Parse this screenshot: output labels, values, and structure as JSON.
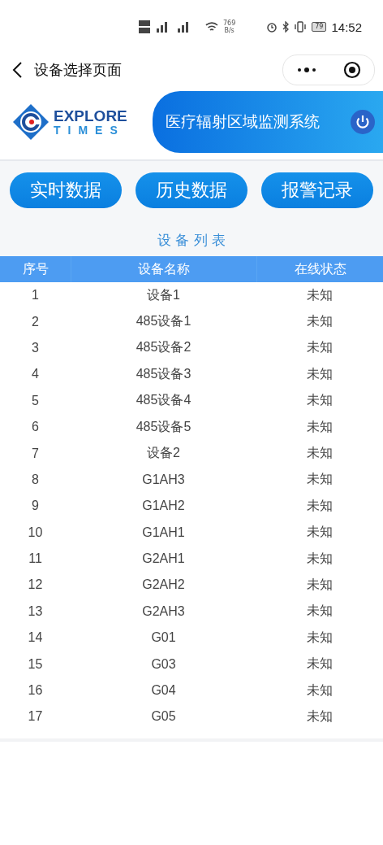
{
  "status_bar": {
    "speed": "769",
    "speed_unit": "B/s",
    "battery": "79",
    "time": "14:52"
  },
  "nav": {
    "title": "设备选择页面"
  },
  "header": {
    "logo_top": "EXPLORE",
    "logo_bottom": "TIMES",
    "system_title": "医疗辐射区域监测系统"
  },
  "buttons": [
    "实时数据",
    "历史数据",
    "报警记录"
  ],
  "table": {
    "title": "设 备 列 表",
    "columns": [
      "序号",
      "设备名称",
      "在线状态"
    ],
    "rows": [
      [
        "1",
        "设备1",
        "未知"
      ],
      [
        "2",
        "485设备1",
        "未知"
      ],
      [
        "3",
        "485设备2",
        "未知"
      ],
      [
        "4",
        "485设备3",
        "未知"
      ],
      [
        "5",
        "485设备4",
        "未知"
      ],
      [
        "6",
        "485设备5",
        "未知"
      ],
      [
        "7",
        "设备2",
        "未知"
      ],
      [
        "8",
        "G1AH3",
        "未知"
      ],
      [
        "9",
        "G1AH2",
        "未知"
      ],
      [
        "10",
        "G1AH1",
        "未知"
      ],
      [
        "11",
        "G2AH1",
        "未知"
      ],
      [
        "12",
        "G2AH2",
        "未知"
      ],
      [
        "13",
        "G2AH3",
        "未知"
      ],
      [
        "14",
        "G01",
        "未知"
      ],
      [
        "15",
        "G03",
        "未知"
      ],
      [
        "16",
        "G04",
        "未知"
      ],
      [
        "17",
        "G05",
        "未知"
      ]
    ]
  }
}
